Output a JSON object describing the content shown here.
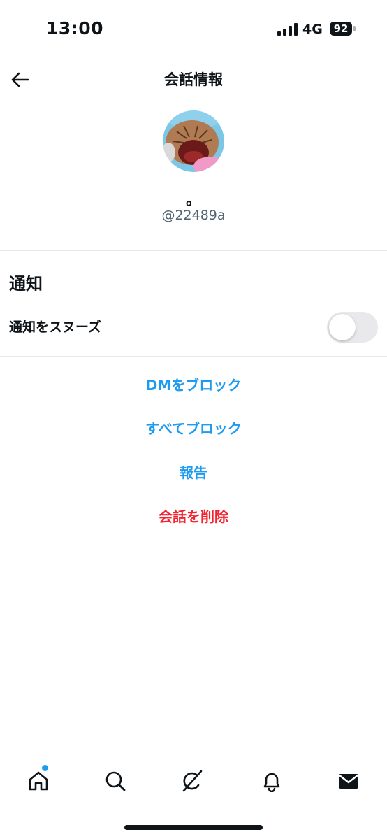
{
  "status_bar": {
    "time": "13:00",
    "network": "4G",
    "battery": "92"
  },
  "header": {
    "title": "会話情報",
    "back_icon": "arrow-left-icon"
  },
  "profile": {
    "display_name": "。",
    "handle": "@22489a",
    "avatar_colors": {
      "background": "#7cc6e6",
      "face": "#b07a52",
      "mouth": "#6b1a1a",
      "pink": "#f29ac7"
    }
  },
  "notifications": {
    "section_title": "通知",
    "snooze_label": "通知をスヌーズ",
    "snooze_enabled": false
  },
  "actions": {
    "block_dm": "DMをブロック",
    "block_all": "すべてブロック",
    "report": "報告",
    "delete_conversation": "会話を削除"
  },
  "tab_bar": {
    "items": [
      "home-icon",
      "search-icon",
      "grok-icon",
      "bell-icon",
      "mail-icon"
    ],
    "home_has_notification": true
  },
  "colors": {
    "accent": "#1d9bf0",
    "danger": "#f4212e",
    "text": "#0f1419",
    "secondary_text": "#536471"
  }
}
